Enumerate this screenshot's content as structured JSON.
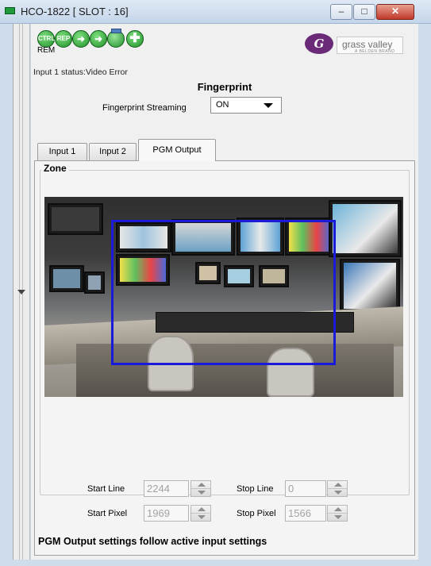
{
  "window": {
    "title": "HCO-1822 [ SLOT : 16]",
    "controls": {
      "minimize": "–",
      "maximize": "□",
      "close": "✕"
    }
  },
  "toolbar": {
    "ctrl_label": "CTRL",
    "rep_label": "REP",
    "rem_label": "REM",
    "icons": [
      "ctrl-icon",
      "rep-icon",
      "arrow-right-icon",
      "arrow-right-icon",
      "loop-icon",
      "plus-icon"
    ]
  },
  "brand": {
    "name": "grass valley",
    "tagline": "A BELDEN BRAND",
    "mark": "G",
    "color": "#6a2a78"
  },
  "status": {
    "text": "Input 1 status:Video Error"
  },
  "fingerprint": {
    "title": "Fingerprint",
    "streaming_label": "Fingerprint Streaming",
    "streaming_value": "ON"
  },
  "tabs": [
    {
      "label": "Input 1",
      "active": false
    },
    {
      "label": "Input 2",
      "active": false
    },
    {
      "label": "PGM Output",
      "active": true
    }
  ],
  "zone": {
    "legend": "Zone",
    "rect_color": "#1a1ad9",
    "fields": {
      "start_line": {
        "label": "Start Line",
        "value": "2244"
      },
      "stop_line": {
        "label": "Stop Line",
        "value": "0"
      },
      "start_pixel": {
        "label": "Start Pixel",
        "value": "1969"
      },
      "stop_pixel": {
        "label": "Stop Pixel",
        "value": "1566"
      }
    }
  },
  "footer": {
    "note": "PGM Output settings follow active input settings"
  }
}
